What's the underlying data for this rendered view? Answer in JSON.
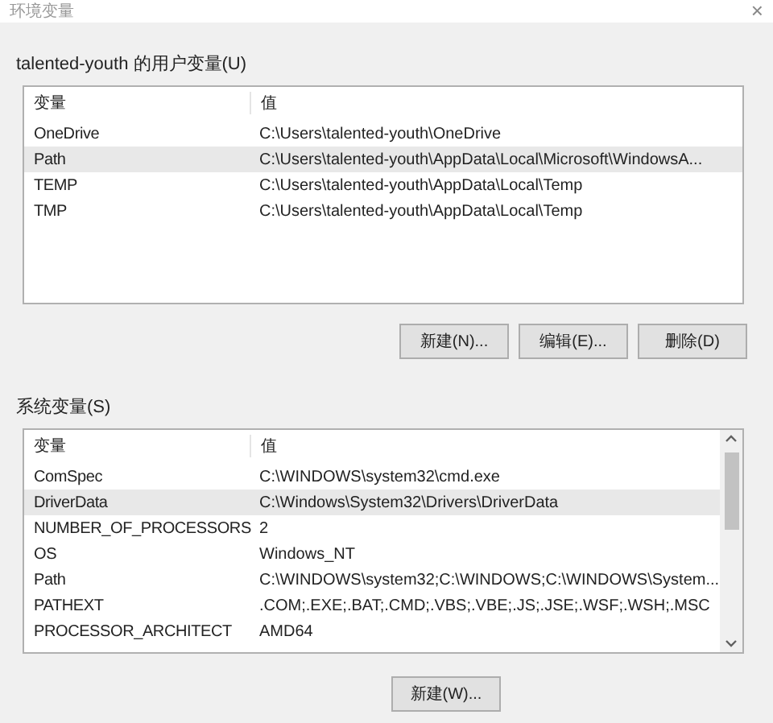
{
  "window": {
    "title": "环境变量",
    "close": "×"
  },
  "user_vars": {
    "label": "talented-youth 的用户变量(U)",
    "columns": [
      "变量",
      "值"
    ],
    "rows": [
      {
        "name": "OneDrive",
        "value": "C:\\Users\\talented-youth\\OneDrive",
        "selected": false
      },
      {
        "name": "Path",
        "value": "C:\\Users\\talented-youth\\AppData\\Local\\Microsoft\\WindowsA...",
        "selected": true
      },
      {
        "name": "TEMP",
        "value": "C:\\Users\\talented-youth\\AppData\\Local\\Temp",
        "selected": false
      },
      {
        "name": "TMP",
        "value": "C:\\Users\\talented-youth\\AppData\\Local\\Temp",
        "selected": false
      }
    ],
    "buttons": [
      "新建(N)...",
      "编辑(E)...",
      "删除(D)"
    ]
  },
  "system_vars": {
    "label": "系统变量(S)",
    "columns": [
      "变量",
      "值"
    ],
    "rows": [
      {
        "name": "ComSpec",
        "value": "C:\\WINDOWS\\system32\\cmd.exe",
        "selected": false
      },
      {
        "name": "DriverData",
        "value": "C:\\Windows\\System32\\Drivers\\DriverData",
        "selected": true
      },
      {
        "name": "NUMBER_OF_PROCESSORS",
        "value": "2",
        "selected": false
      },
      {
        "name": "OS",
        "value": "Windows_NT",
        "selected": false
      },
      {
        "name": "Path",
        "value": "C:\\WINDOWS\\system32;C:\\WINDOWS;C:\\WINDOWS\\System...",
        "selected": false
      },
      {
        "name": "PATHEXT",
        "value": ".COM;.EXE;.BAT;.CMD;.VBS;.VBE;.JS;.JSE;.WSF;.WSH;.MSC",
        "selected": false
      },
      {
        "name": "PROCESSOR_ARCHITECT",
        "value": "AMD64",
        "selected": false
      }
    ],
    "buttons": [
      "新建(W)..."
    ]
  }
}
